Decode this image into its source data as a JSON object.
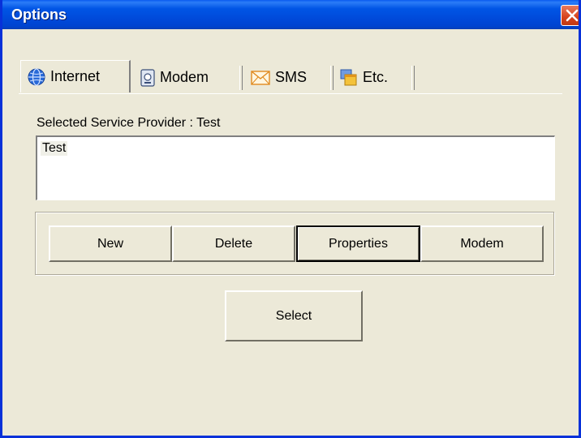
{
  "window": {
    "title": "Options"
  },
  "tabs": [
    {
      "label": "Internet",
      "icon": "globe-icon",
      "active": true
    },
    {
      "label": "Modem",
      "icon": "modem-icon",
      "active": false
    },
    {
      "label": "SMS",
      "icon": "envelope-icon",
      "active": false
    },
    {
      "label": "Etc.",
      "icon": "windows-icon",
      "active": false
    }
  ],
  "provider": {
    "label": "Selected Service Provider : Test",
    "items": [
      "Test"
    ]
  },
  "buttons": {
    "new": "New",
    "delete": "Delete",
    "properties": "Properties",
    "modem": "Modem",
    "select": "Select"
  },
  "colors": {
    "titlebar": "#0055e5",
    "face": "#ece9d8",
    "close": "#d6431c"
  }
}
